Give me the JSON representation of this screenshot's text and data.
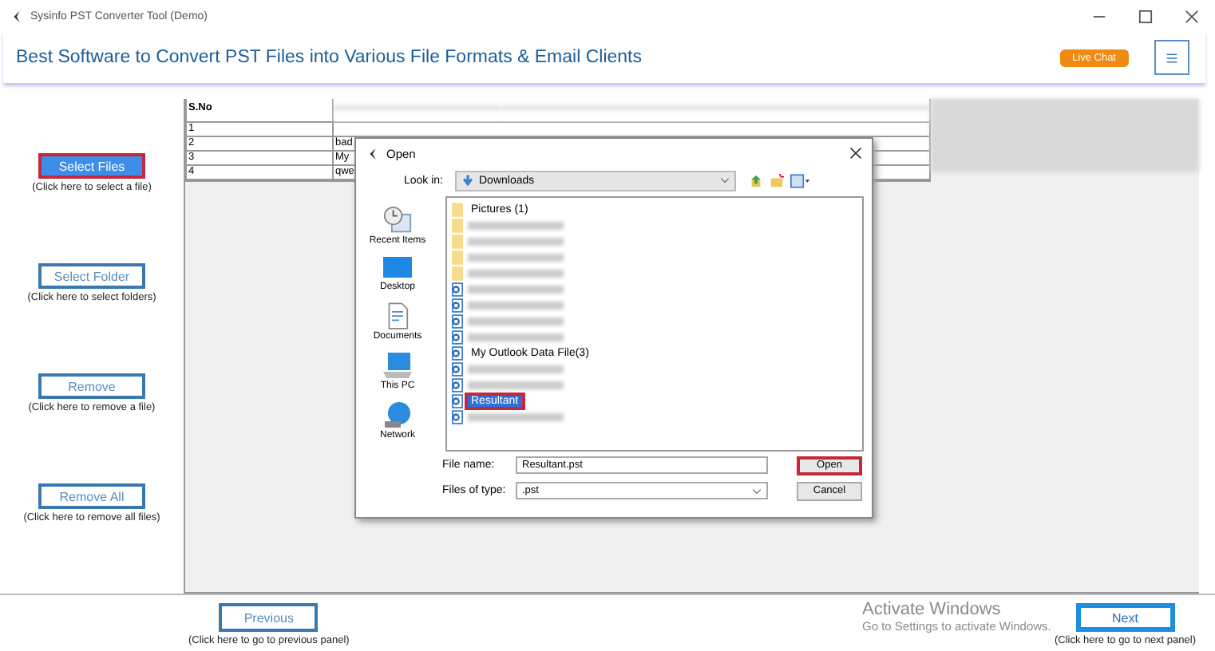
{
  "window": {
    "title": "Sysinfo PST Converter Tool (Demo)"
  },
  "header": {
    "headline": "Best Software to Convert PST Files into Various File Formats & Email Clients",
    "live_chat": "Live Chat"
  },
  "side_buttons": [
    {
      "label": "Select Files",
      "hint": "(Click here to select a file)",
      "highlighted": true
    },
    {
      "label": "Select Folder",
      "hint": "(Click here to select folders)",
      "highlighted": false
    },
    {
      "label": "Remove",
      "hint": "(Click here to remove a file)",
      "highlighted": false
    },
    {
      "label": "Remove All",
      "hint": "(Click here to remove all files)",
      "highlighted": false
    }
  ],
  "table": {
    "columns": [
      "S.No"
    ],
    "rows": [
      {
        "s_no": "1"
      },
      {
        "s_no": "2",
        "column_2": "bad"
      },
      {
        "s_no": "3",
        "column_2": "My"
      },
      {
        "s_no": "4",
        "column_2": "qwe"
      }
    ]
  },
  "dialog": {
    "title": "Open",
    "look_in_label": "Look in:",
    "look_in": "Downloads",
    "places": [
      {
        "kind": "recent",
        "label": "Recent Items"
      },
      {
        "kind": "desktop",
        "label": "Desktop"
      },
      {
        "kind": "documents",
        "label": "Documents"
      },
      {
        "kind": "computer",
        "label": "This PC"
      },
      {
        "kind": "network",
        "label": "Network"
      }
    ],
    "files": [
      {
        "kind": "folder",
        "name": "Pictures (1)",
        "selected": false
      },
      {
        "kind": "folder",
        "selected": false
      },
      {
        "kind": "folder",
        "selected": false
      },
      {
        "kind": "folder",
        "selected": false
      },
      {
        "kind": "folder",
        "selected": false
      },
      {
        "kind": "pst",
        "selected": false
      },
      {
        "kind": "pst",
        "selected": false
      },
      {
        "kind": "pst",
        "selected": false
      },
      {
        "kind": "pst",
        "selected": false
      },
      {
        "kind": "pst",
        "name": "My Outlook Data File(3)",
        "selected": false
      },
      {
        "kind": "pst",
        "selected": false
      },
      {
        "kind": "pst",
        "selected": false
      },
      {
        "kind": "pst",
        "name": "Resultant",
        "selected": true
      },
      {
        "kind": "pst",
        "selected": false
      }
    ],
    "file_name_label": "File name:",
    "file_name": "Resultant.pst",
    "file_type_label": "Files of type:",
    "file_type": ".pst",
    "buttons": [
      {
        "label": "Open",
        "highlighted": true
      },
      {
        "label": "Cancel",
        "highlighted": false
      }
    ]
  },
  "nav": [
    {
      "label": "Previous",
      "hint": "(Click here to go to previous panel)",
      "focused": false
    },
    {
      "label": "Next",
      "hint": "(Click here to go to next panel)",
      "focused": true
    }
  ],
  "os_notice": {
    "title": "Activate Windows",
    "text": "Go to Settings to activate Windows."
  }
}
